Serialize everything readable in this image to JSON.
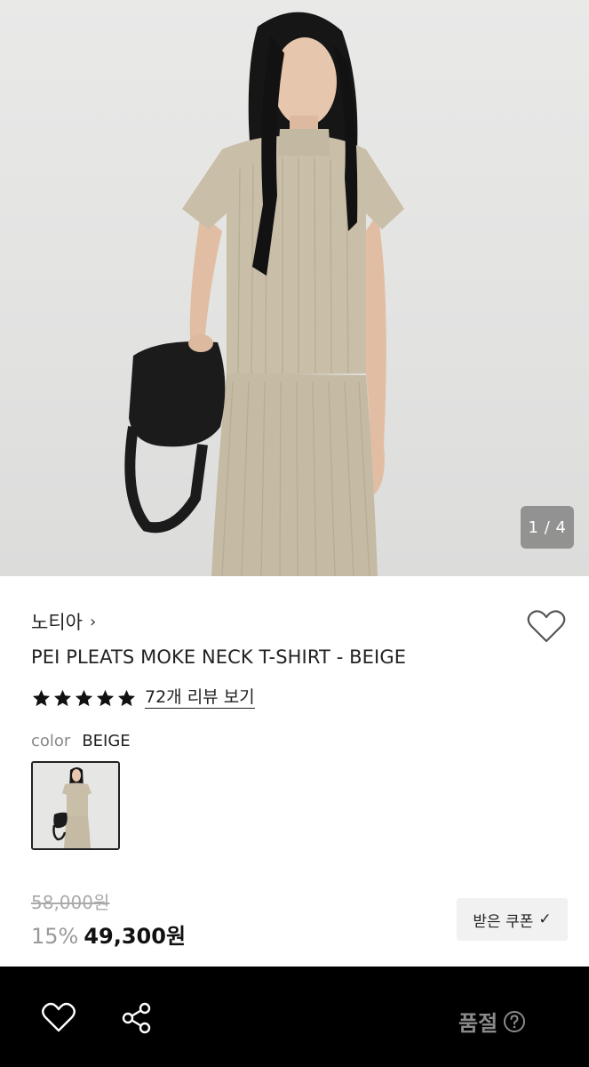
{
  "gallery": {
    "counter": "1 / 4"
  },
  "product": {
    "brand": "노티아",
    "brand_chevron": "›",
    "title": "PEI PLEATS MOKE NECK T-SHIRT - BEIGE",
    "rating_stars": 5,
    "review_link": "72개 리뷰 보기",
    "color_label": "color",
    "color_value": "BEIGE",
    "original_price": "58,000원",
    "discount": "15%",
    "price": "49,300원",
    "coupon_label": "받은 쿠폰",
    "coupon_check": "✓"
  },
  "bottom_bar": {
    "soldout_label": "품절"
  },
  "icons": {
    "wishlist": "heart-outline-icon",
    "share": "share-icon",
    "help": "question-circle-icon",
    "star": "star-filled-icon"
  },
  "colors": {
    "bottom_bar_bg": "#000000",
    "soldout_text": "#8a8a8a",
    "fabric": "#c8bda6",
    "bag": "#1b1b1b"
  }
}
